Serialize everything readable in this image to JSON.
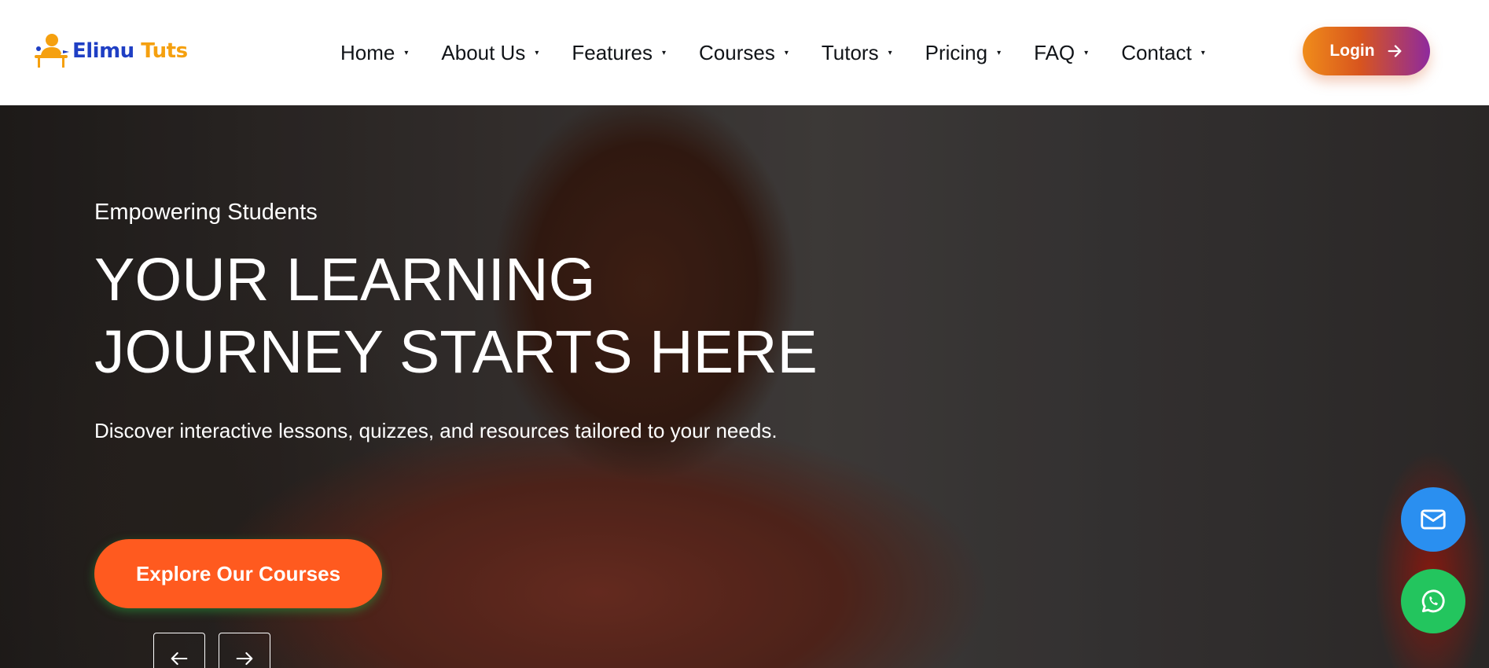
{
  "brand": {
    "name_part1": "Elimu",
    "name_part2": "Tuts",
    "logo_icon": "student-desk-icon",
    "colors": {
      "blue": "#1f3fc4",
      "orange": "#f5a00f"
    }
  },
  "nav": {
    "items": [
      {
        "label": "Home"
      },
      {
        "label": "About Us"
      },
      {
        "label": "Features"
      },
      {
        "label": "Courses"
      },
      {
        "label": "Tutors"
      },
      {
        "label": "Pricing"
      },
      {
        "label": "FAQ"
      },
      {
        "label": "Contact"
      }
    ],
    "caret": "▾"
  },
  "login": {
    "label": "Login",
    "icon": "arrow-right-icon"
  },
  "hero": {
    "subtitle": "Empowering Students",
    "title_line1": "YOUR LEARNING",
    "title_line2": "JOURNEY STARTS HERE",
    "description": "Discover interactive lessons, quizzes, and resources tailored to your needs.",
    "cta_label": "Explore Our Courses",
    "cta_color": "#ff5a1f",
    "prev_icon": "arrow-left-icon",
    "next_icon": "arrow-right-icon"
  },
  "floating": {
    "email_icon": "mail-icon",
    "email_color": "#2a8ff0",
    "whatsapp_icon": "whatsapp-icon",
    "whatsapp_color": "#23c55e"
  }
}
